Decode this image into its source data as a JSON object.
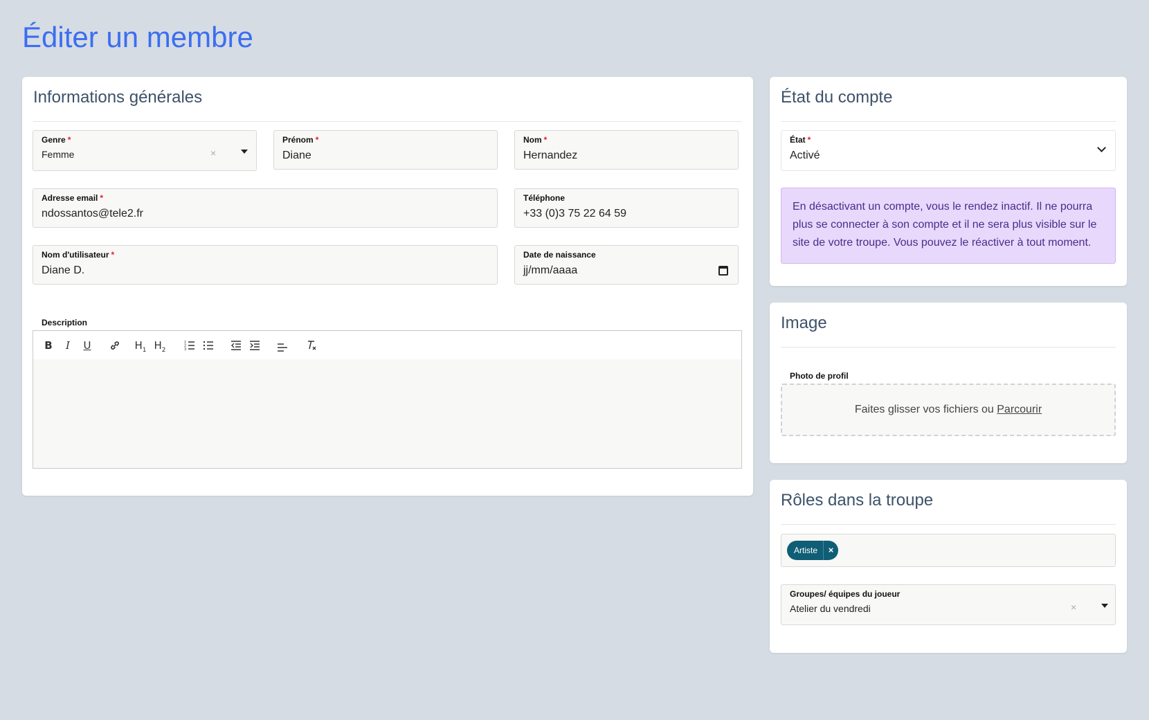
{
  "page": {
    "title": "Éditer un membre"
  },
  "general": {
    "title": "Informations générales",
    "genre": {
      "label": "Genre",
      "value": "Femme",
      "clear": "×"
    },
    "prenom": {
      "label": "Prénom",
      "value": "Diane"
    },
    "nom": {
      "label": "Nom",
      "value": "Hernandez"
    },
    "email": {
      "label": "Adresse email",
      "value": "ndossantos@tele2.fr"
    },
    "telephone": {
      "label": "Téléphone",
      "value": "+33 (0)3 75 22 64 59"
    },
    "username": {
      "label": "Nom d'utilisateur",
      "value": "Diane D."
    },
    "birthdate": {
      "label": "Date de naissance",
      "value": "jj/mm/aaaa"
    },
    "description": {
      "label": "Description",
      "toolbar": {
        "bold": "B",
        "italic": "I",
        "underline": "U",
        "link": "🔗",
        "h1": "H",
        "h2": "H",
        "h1_sub": "1",
        "h2_sub": "2",
        "ordered_list": "☰",
        "bullet_list": "☰",
        "outdent": "⇤",
        "indent": "⇥",
        "align": "☰",
        "clear_format": "T"
      }
    },
    "required_mark": "*"
  },
  "account": {
    "title": "État du compte",
    "etat": {
      "label": "État",
      "value": "Activé"
    },
    "notice": "En désactivant un compte, vous le rendez inactif. Il ne pourra plus se connecter à son compte et il ne sera plus visible sur le site de votre troupe. Vous pouvez le réactiver à tout moment."
  },
  "image": {
    "title": "Image",
    "label": "Photo de profil",
    "drop_text": "Faites glisser vos fichiers ou ",
    "browse": "Parcourir"
  },
  "roles": {
    "title": "Rôles dans la troupe",
    "tags": [
      {
        "label": "Artiste",
        "remove": "×"
      }
    ],
    "groups": {
      "label": "Groupes/ équipes du joueur",
      "value": "Atelier du vendredi",
      "clear": "×"
    }
  },
  "colors": {
    "accent": "#3b6ef0",
    "background": "#d6dce4",
    "chip": "#0f5e75",
    "notice_bg": "#e8d8fb",
    "required": "#e11d2d"
  },
  "icons": [
    "calendar-icon",
    "chevron-down-icon",
    "caret-down-icon",
    "clear-icon",
    "close-icon"
  ]
}
